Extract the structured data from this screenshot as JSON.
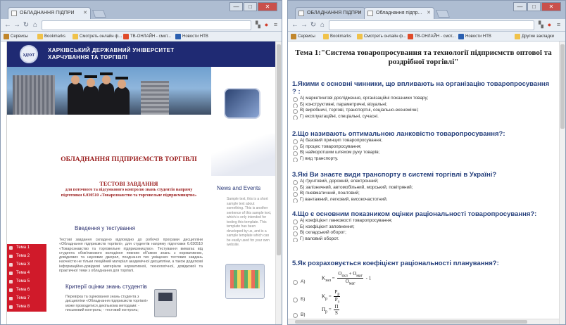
{
  "left_window": {
    "tabs": [
      {
        "label": "ОБЛАДНАННЯ ПІДПРИ"
      }
    ],
    "window_controls": {
      "minimize": "—",
      "maximize": "□",
      "close": "✕"
    },
    "bookmarks": [
      {
        "label": "Сервисы"
      },
      {
        "label": "Bookmarks"
      },
      {
        "label": "Смотреть онлайн ф..."
      },
      {
        "label": "TB-ОНЛАЙН - смот..."
      },
      {
        "label": "Новости НТВ"
      }
    ],
    "site": {
      "logo_text": "ХДУХТ",
      "university_name": "ХАРКІВСЬКИЙ ДЕРЖАВНИЙ УНІВЕРСИТЕТ ХАРЧУВАННЯ ТА ТОРГІВЛІ",
      "page_title": "ОБЛАДНАННЯ ПІДПРИЄМСТВ ТОРГІВЛІ",
      "tests_title": "ТЕСТОВІ ЗАВДАННЯ",
      "tests_subtitle": "для поточного та підсумкового контролю знань студентів напряму підготовки 6.030510 «Товарознавство та торговельне підприємництво»",
      "intro_title": "Введення у тестування",
      "intro_text": "Тестові завдання складено відповідно до робочої програми дисципліни «Обладнання підприємств торгівлі», для студентів напряму підготовки 6.030510 «Товарознавство та торговельне підприємництво». Тестування вимагає від студента обов'язкового володіння певним об'ємом знань з нормативних, довідкових та наукових джерел, поєднання тих уміщених тестових завдань наочністю не тільки лекційний матеріал академічної дисципліни, а також додаткові інформаційно-довідкові матеріали нормативної, технологічної, довідкової та практичної теми з обладнання для торгівлі.",
      "criteria_title": "Критерії оцінки знань студентів",
      "criteria_text": "Перевірка та оцінювання знань студента з дисципліни «Обладнання підприємств торгівлі» може проводитися декількома методами: - письмовий контроль; - тестовий контроль;",
      "news_title": "News and Events",
      "news_text": "Sample text, this is a short sample text about something. This is another sentence of this sample text, which is only intended for testing this template. This template has been developed by us, and is a sample template which can be easily used for your own website.",
      "nav_items": [
        {
          "label": "Тема 1"
        },
        {
          "label": "Тема 2"
        },
        {
          "label": "Тема 3"
        },
        {
          "label": "Тема 4"
        },
        {
          "label": "Тема 5"
        },
        {
          "label": "Тема 6"
        },
        {
          "label": "Тема 7"
        },
        {
          "label": "Тема 8"
        }
      ]
    }
  },
  "right_window": {
    "tabs": [
      {
        "label": "ОБЛАДНАННЯ ПІДПРИ"
      },
      {
        "label": "Обладнання підпр..."
      }
    ],
    "window_controls": {
      "minimize": "—",
      "maximize": "□",
      "close": "✕"
    },
    "bookmarks": [
      {
        "label": "Сервисы"
      },
      {
        "label": "Bookmarks"
      },
      {
        "label": "Смотреть онлайн ф..."
      },
      {
        "label": "TB-ОНЛАЙН - смот..."
      },
      {
        "label": "Новости НТВ"
      },
      {
        "label": "Другие закладки"
      }
    ],
    "doc": {
      "title": "Тема 1:\"Система товаропросування та технології підприємств оптової та роздрібної торгівлі\"",
      "questions": [
        {
          "title": "1.Якими є основні чинники, що впливають на організацію товаропросування ? :",
          "options": [
            "А) маркетингові дослідження, організаційні показники товару;",
            "Б) конструктивні, параметричні, візуальні;",
            "В) виробничі, торгові, транспортні, соціально-економічні;",
            "Г) експлуатаційні, спеціальні, сучасні."
          ]
        },
        {
          "title": "2.Що називають оптимальною ланковістю товаропросування?:",
          "options": [
            "А) базовий принцип товаропросування;",
            "Б) процес товаропросування;",
            "В) найкоротшим шляхом руху товарів;",
            "Г) вид транспорту."
          ]
        },
        {
          "title": "3.Які Ви знаєте види транспорту в системі торгівлі в Україні?",
          "options": [
            "А) ґрунтовий, дорожній, електронний;",
            "Б) залізничний, автомобільний, морський, повітряний;",
            "В) пневматичний, поштовий;",
            "Г) вантажний, легковий, високочастотний."
          ]
        },
        {
          "title": "4.Що є основним показником оцінки раціональності товаропросування?:",
          "options": [
            "А) коефіцієнт ланковості товаропросування;",
            "Б) коефіцієнт заповнення;",
            "В) складський оборот;",
            "Г) валовий оборот."
          ]
        },
        {
          "title": "5.Як розраховується коефіцієнт раціональності планування?:",
          "formula_options": [
            {
              "label": "А)",
              "formula": "Kзал = (Oскл + Oмаг) / Oмаг - 1"
            },
            {
              "label": "Б)",
              "formula": "Kр = Pp / Pз"
            },
            {
              "label": "В)",
              "formula": "Пр = П / S"
            }
          ]
        }
      ]
    }
  }
}
